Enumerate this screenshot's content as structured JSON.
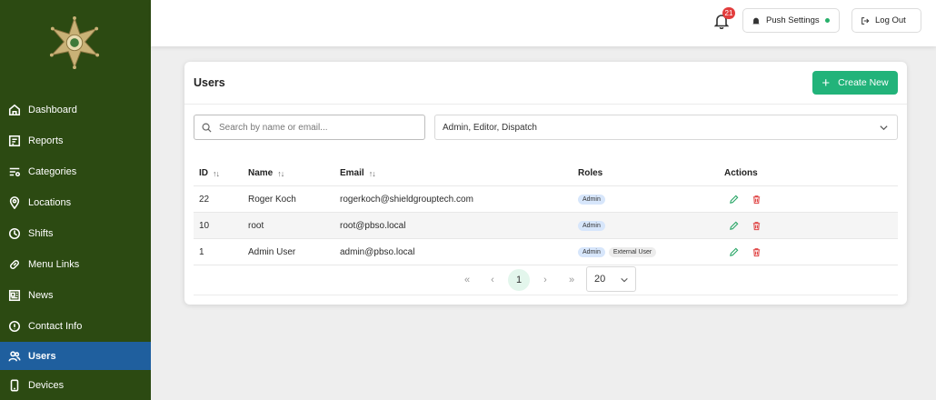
{
  "sidebar": {
    "items": [
      {
        "label": "Dashboard",
        "icon": "home-icon"
      },
      {
        "label": "Reports",
        "icon": "report-icon"
      },
      {
        "label": "Categories",
        "icon": "categories-icon"
      },
      {
        "label": "Locations",
        "icon": "location-pin-icon"
      },
      {
        "label": "Shifts",
        "icon": "clock-icon"
      },
      {
        "label": "Menu Links",
        "icon": "link-icon"
      },
      {
        "label": "News",
        "icon": "newspaper-icon"
      },
      {
        "label": "Contact Info",
        "icon": "info-icon"
      },
      {
        "label": "Users",
        "icon": "users-icon",
        "active": true
      },
      {
        "label": "Devices",
        "icon": "phone-icon"
      }
    ]
  },
  "topbar": {
    "notification_count": "21",
    "push_settings_label": "Push Settings",
    "logout_label": "Log Out"
  },
  "main": {
    "title": "Users",
    "create_label": "Create New",
    "search_placeholder": "Search by name or email...",
    "role_filter": "Admin, Editor, Dispatch",
    "columns": {
      "id": "ID",
      "name": "Name",
      "email": "Email",
      "roles": "Roles",
      "actions": "Actions"
    },
    "rows": [
      {
        "id": "22",
        "name": "Roger Koch",
        "email": "rogerkoch@shieldgrouptech.com",
        "roles": [
          "Admin"
        ]
      },
      {
        "id": "10",
        "name": "root",
        "email": "root@pbso.local",
        "roles": [
          "Admin"
        ]
      },
      {
        "id": "1",
        "name": "Admin User",
        "email": "admin@pbso.local",
        "roles": [
          "Admin",
          "External User"
        ]
      }
    ],
    "pagination": {
      "current_page": "1",
      "per_page": "20"
    }
  },
  "colors": {
    "sidebar_bg": "#2c4a12",
    "active_nav": "#1f5f9e",
    "primary_button": "#22b37a",
    "badge": "#e23d3d",
    "status_dot": "#27b06a",
    "edit_icon": "#27a565",
    "delete_icon": "#e04848"
  }
}
